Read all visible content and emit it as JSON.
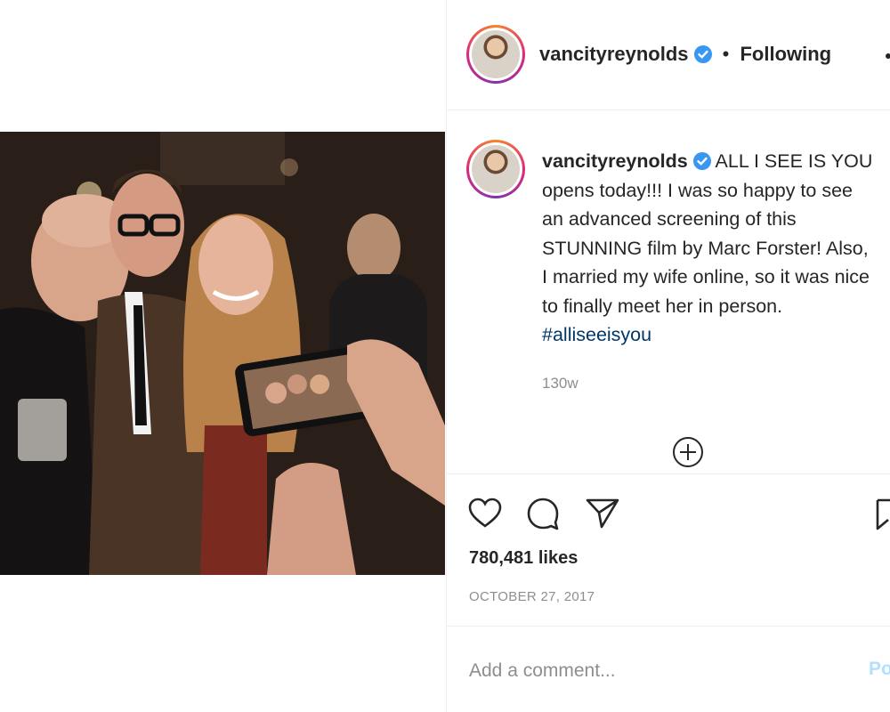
{
  "header": {
    "username": "vancityreynolds",
    "separator": "•",
    "follow_status": "Following",
    "more_icon": "more-dots-icon",
    "verified_icon": "verified-badge-icon"
  },
  "post": {
    "caption_user": "vancityreynolds",
    "caption_lines": [
      "ALL I SEE IS YOU",
      "opens today!!! I was so happy to see",
      "an advanced screening of this",
      "STUNNING film by Marc Forster! Also,",
      "I married my wife online, so it was nice",
      "to finally meet her in person."
    ],
    "hashtag": "#alliseeisyou",
    "time_ago": "130w",
    "load_more_icon": "plus-circle-icon"
  },
  "actions": {
    "like_icon": "heart-icon",
    "comment_icon": "comment-icon",
    "share_icon": "share-icon",
    "save_icon": "bookmark-icon"
  },
  "stats": {
    "likes": "780,481 likes",
    "date": "OCTOBER 27, 2017"
  },
  "comment": {
    "placeholder": "Add a comment...",
    "post_label": "Post"
  },
  "colors": {
    "verified": "#3897f0",
    "hashtag": "#00376b",
    "muted": "#8e8e8e",
    "post_button": "#b2dffc",
    "divider": "#efefef"
  }
}
